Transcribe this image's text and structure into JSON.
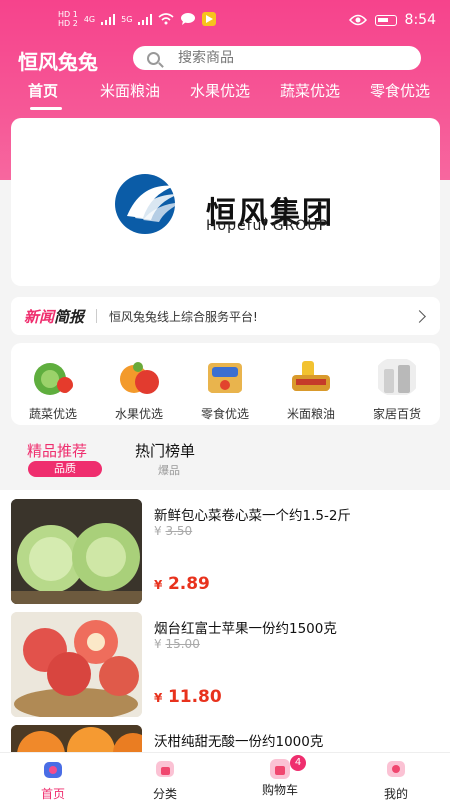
{
  "status_bar": {
    "sim1": "HD 1",
    "sim2": "HD 2",
    "net1": "4G",
    "net2": "5G",
    "time": "8:54"
  },
  "header": {
    "logo": "恒风兔兔",
    "search_placeholder": "搜索商品",
    "tabs": [
      "首页",
      "米面粮油",
      "水果优选",
      "蔬菜优选",
      "零食优选"
    ],
    "active_tab": 0
  },
  "banner": {
    "cn": "恒风集团",
    "en": "Hopeful GROUP"
  },
  "news": {
    "tag_a": "新闻",
    "tag_b": "简报",
    "text": "恒风兔兔线上综合服务平台!"
  },
  "categories": [
    {
      "label": "蔬菜优选",
      "color": "#5fae3e"
    },
    {
      "label": "水果优选",
      "color": "#f39a2b"
    },
    {
      "label": "零食优选",
      "color": "#e9b44d"
    },
    {
      "label": "米面粮油",
      "color": "#d99a2c"
    },
    {
      "label": "家居百货",
      "color": "#cfcfcf"
    }
  ],
  "section": {
    "tab1": "精品推荐",
    "tab1_sub": "品质",
    "tab2": "热门榜单",
    "tab2_sub": "爆品"
  },
  "products": [
    {
      "name": "新鲜包心菜卷心菜一个约1.5-2斤",
      "currency": "¥",
      "old_price": "3.50",
      "price": "2.89"
    },
    {
      "name": "烟台红富士苹果一份约1500克",
      "currency": "¥",
      "old_price": "15.00",
      "price": "11.80"
    },
    {
      "name": "沃柑纯甜无酸一份约1000克",
      "currency": "¥",
      "old_price": "",
      "price": ""
    }
  ],
  "bottom_nav": {
    "items": [
      "首页",
      "分类",
      "购物车",
      "我的"
    ],
    "cart_badge": "4",
    "active": 0
  },
  "colors": {
    "brand": "#f6438c",
    "accent": "#ef2e6e",
    "price": "#e8321d"
  }
}
